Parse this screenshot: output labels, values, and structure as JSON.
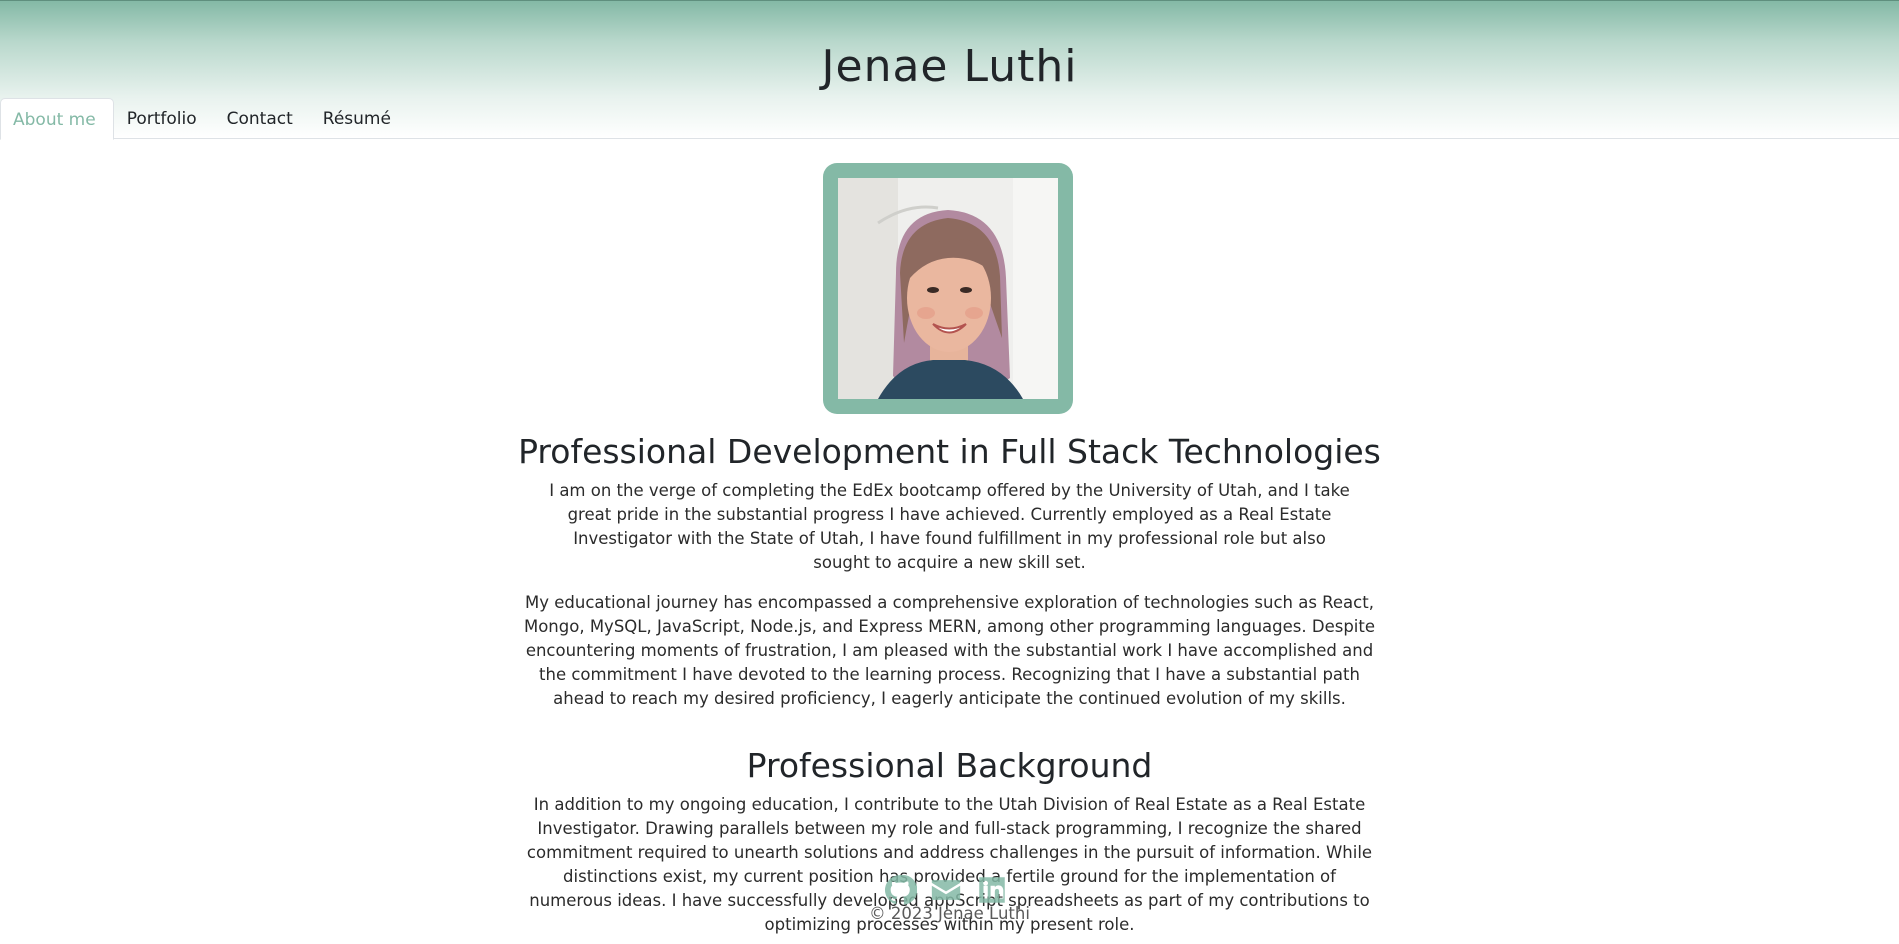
{
  "site": {
    "title": "Jenae Luthi"
  },
  "nav": {
    "items": [
      {
        "label": "About me",
        "active": true
      },
      {
        "label": "Portfolio",
        "active": false
      },
      {
        "label": "Contact",
        "active": false
      },
      {
        "label": "Résumé",
        "active": false
      }
    ]
  },
  "colors": {
    "accent": "#84b9a6",
    "text": "#212529"
  },
  "about": {
    "photo_alt": "Portrait of Jenae Luthi",
    "section1_title": "Professional Development in Full Stack Technologies",
    "section1_para1": "I am on the verge of completing the EdEx bootcamp offered by the University of Utah, and I take great pride in the substantial progress I have achieved. Currently employed as a Real Estate Investigator with the State of Utah, I have found fulfillment in my professional role but also sought to acquire a new skill set.",
    "section1_para2": "My educational journey has encompassed a comprehensive exploration of technologies such as React, Mongo, MySQL, JavaScript, Node.js, and Express MERN, among other programming languages. Despite encountering moments of frustration, I am pleased with the substantial work I have accomplished and the commitment I have devoted to the learning process. Recognizing that I have a substantial path ahead to reach my desired proficiency, I eagerly anticipate the continued evolution of my skills.",
    "section2_title": "Professional Background",
    "section2_para1": "In addition to my ongoing education, I contribute to the Utah Division of Real Estate as a Real Estate Investigator. Drawing parallels between my role and full-stack programming, I recognize the shared commitment required to unearth solutions and address challenges in the pursuit of information. While distinctions exist, my current position has provided a fertile ground for the implementation of numerous ideas. I have successfully developed appScript spreadsheets as part of my contributions to optimizing processes within my present role."
  },
  "footer": {
    "icons": [
      "github-icon",
      "email-icon",
      "linkedin-icon"
    ],
    "copyright": "© 2023 Jenae Luthi"
  }
}
